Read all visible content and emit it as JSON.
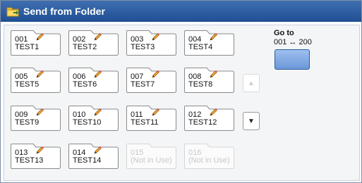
{
  "window": {
    "title": "Send from Folder",
    "title_icon": "folder-send-icon"
  },
  "folders": [
    {
      "num": "001",
      "name": "TEST1",
      "in_use": true
    },
    {
      "num": "002",
      "name": "TEST2",
      "in_use": true
    },
    {
      "num": "003",
      "name": "TEST3",
      "in_use": true
    },
    {
      "num": "004",
      "name": "TEST4",
      "in_use": true
    },
    {
      "num": "005",
      "name": "TEST5",
      "in_use": true
    },
    {
      "num": "006",
      "name": "TEST6",
      "in_use": true
    },
    {
      "num": "007",
      "name": "TEST7",
      "in_use": true
    },
    {
      "num": "008",
      "name": "TEST8",
      "in_use": true
    },
    {
      "num": "009",
      "name": "TEST9",
      "in_use": true
    },
    {
      "num": "010",
      "name": "TEST10",
      "in_use": true
    },
    {
      "num": "011",
      "name": "TEST11",
      "in_use": true
    },
    {
      "num": "012",
      "name": "TEST12",
      "in_use": true
    },
    {
      "num": "013",
      "name": "TEST13",
      "in_use": true
    },
    {
      "num": "014",
      "name": "TEST14",
      "in_use": true
    },
    {
      "num": "015",
      "name": "(Not in Use)",
      "in_use": false
    },
    {
      "num": "016",
      "name": "(Not in Use)",
      "in_use": false
    }
  ],
  "scroll": {
    "up_icon": "▲",
    "down_icon": "▼"
  },
  "goto": {
    "label": "Go to",
    "range": "001 ↔ 200"
  },
  "colors": {
    "titlebar": "#2b5fa3",
    "accent": "#7aa3e0"
  }
}
